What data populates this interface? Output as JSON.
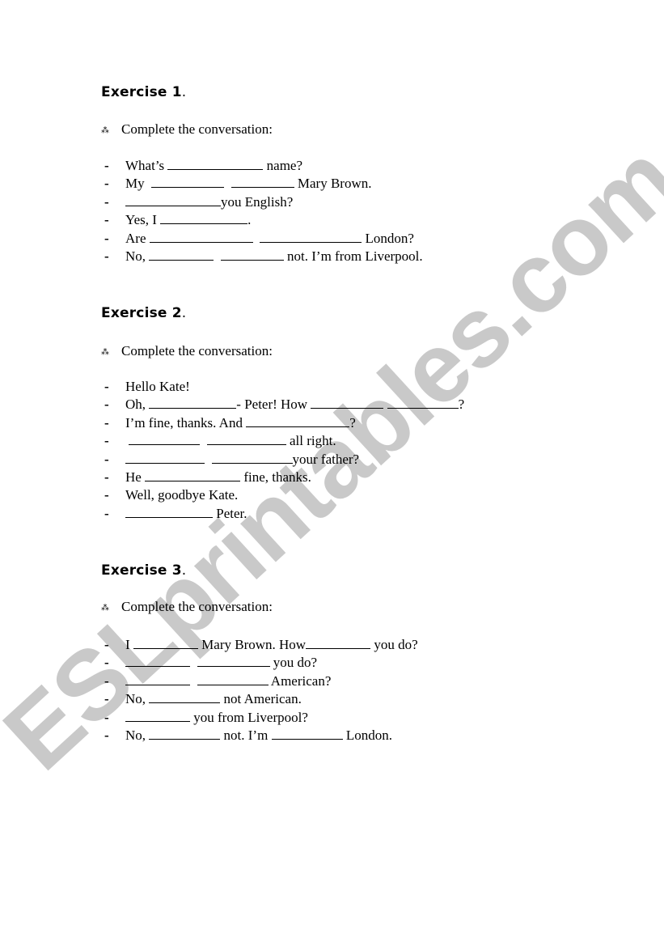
{
  "watermark": "ESLprintables.com",
  "bullet_symbol": "⁂",
  "dash": "-",
  "exercises": [
    {
      "title": "Exercise 1",
      "title_suffix": ".",
      "instruction": "Complete the conversation:",
      "lines": [
        {
          "parts": [
            {
              "t": "What’s "
            },
            {
              "b": 118
            },
            {
              "t": " name?"
            }
          ]
        },
        {
          "parts": [
            {
              "t": "My  "
            },
            {
              "b": 90
            },
            {
              "t": "  "
            },
            {
              "b": 78
            },
            {
              "t": " Mary Brown."
            }
          ]
        },
        {
          "parts": [
            {
              "b": 118
            },
            {
              "t": "you English?"
            }
          ]
        },
        {
          "parts": [
            {
              "t": "Yes, I "
            },
            {
              "b": 108
            },
            {
              "t": "."
            }
          ]
        },
        {
          "parts": [
            {
              "t": "Are "
            },
            {
              "b": 128
            },
            {
              "t": "  "
            },
            {
              "b": 126
            },
            {
              "t": " London?"
            }
          ]
        },
        {
          "parts": [
            {
              "t": "No, "
            },
            {
              "b": 80
            },
            {
              "t": "  "
            },
            {
              "b": 78
            },
            {
              "t": " not. I’m from Liverpool."
            }
          ]
        }
      ]
    },
    {
      "title": "Exercise 2",
      "title_suffix": ".",
      "instruction": "Complete the conversation:",
      "lines": [
        {
          "parts": [
            {
              "t": "Hello Kate!"
            }
          ]
        },
        {
          "parts": [
            {
              "t": "Oh, "
            },
            {
              "b": 108
            },
            {
              "t": "- Peter! How "
            },
            {
              "b": 90
            },
            {
              "t": " "
            },
            {
              "b": 88
            },
            {
              "t": "?"
            }
          ]
        },
        {
          "parts": [
            {
              "t": "I’m fine, thanks. And "
            },
            {
              "b": 128
            },
            {
              "t": "?"
            }
          ]
        },
        {
          "parts": [
            {
              "t": " "
            },
            {
              "b": 88
            },
            {
              "t": "  "
            },
            {
              "b": 98
            },
            {
              "t": " all right."
            }
          ]
        },
        {
          "parts": [
            {
              "b": 98
            },
            {
              "t": "  "
            },
            {
              "b": 100
            },
            {
              "t": "your father?"
            }
          ]
        },
        {
          "parts": [
            {
              "t": "He "
            },
            {
              "b": 118
            },
            {
              "t": " fine, thanks."
            }
          ]
        },
        {
          "parts": [
            {
              "t": "Well, goodbye Kate."
            }
          ]
        },
        {
          "parts": [
            {
              "b": 108
            },
            {
              "t": " Peter."
            }
          ]
        }
      ]
    },
    {
      "title": "Exercise 3",
      "title_suffix": ".",
      "instruction": "Complete the conversation:",
      "lines": [
        {
          "parts": [
            {
              "t": "I "
            },
            {
              "b": 80
            },
            {
              "t": " Mary Brown. How"
            },
            {
              "b": 80
            },
            {
              "t": " you do?"
            }
          ]
        },
        {
          "parts": [
            {
              "b": 80
            },
            {
              "t": "  "
            },
            {
              "b": 90
            },
            {
              "t": " you do?"
            }
          ]
        },
        {
          "parts": [
            {
              "b": 80
            },
            {
              "t": "  "
            },
            {
              "b": 88
            },
            {
              "t": " American?"
            }
          ]
        },
        {
          "parts": [
            {
              "t": "No, "
            },
            {
              "b": 88
            },
            {
              "t": " not American."
            }
          ]
        },
        {
          "parts": [
            {
              "b": 80
            },
            {
              "t": " you from Liverpool?"
            }
          ]
        },
        {
          "parts": [
            {
              "t": "No, "
            },
            {
              "b": 88
            },
            {
              "t": " not. I’m "
            },
            {
              "b": 88
            },
            {
              "t": " London."
            }
          ]
        }
      ]
    }
  ]
}
